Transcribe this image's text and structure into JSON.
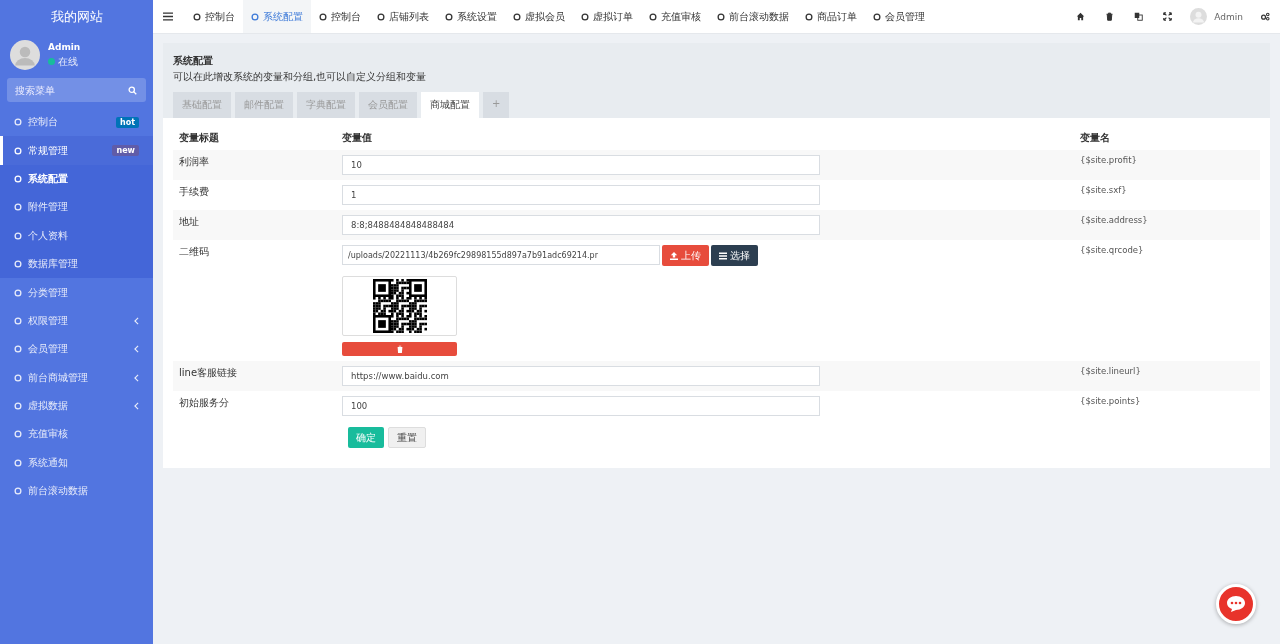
{
  "sidebar": {
    "site_title": "我的网站",
    "user": {
      "name": "Admin",
      "status": "在线",
      "online": true
    },
    "search": {
      "placeholder": "搜索菜单"
    },
    "items": [
      {
        "label": "控制台",
        "badge": {
          "text": "hot",
          "color": "#0073b7"
        },
        "selected": false
      },
      {
        "label": "常规管理",
        "badge": {
          "text": "new",
          "color": "#605ca8"
        },
        "selected": true,
        "expanded": true,
        "children": [
          {
            "label": "系统配置",
            "selected": true
          },
          {
            "label": "附件管理",
            "selected": false
          },
          {
            "label": "个人资料",
            "selected": false
          },
          {
            "label": "数据库管理",
            "selected": false
          }
        ]
      },
      {
        "label": "分类管理",
        "selected": false
      },
      {
        "label": "权限管理",
        "selected": false,
        "expanded": false
      },
      {
        "label": "会员管理",
        "selected": false,
        "expanded": false
      },
      {
        "label": "前台商城管理",
        "selected": false,
        "expanded": false
      },
      {
        "label": "虚拟数据",
        "selected": false,
        "expanded": false
      },
      {
        "label": "充值审核",
        "selected": false
      },
      {
        "label": "系统通知",
        "selected": false
      },
      {
        "label": "前台滚动数据",
        "selected": false
      }
    ]
  },
  "top_tabs": [
    {
      "label": "控制台",
      "selected": false
    },
    {
      "label": "系统配置",
      "selected": true
    },
    {
      "label": "控制台",
      "selected": false
    },
    {
      "label": "店铺列表",
      "selected": false
    },
    {
      "label": "系统设置",
      "selected": false
    },
    {
      "label": "虚拟会员",
      "selected": false
    },
    {
      "label": "虚拟订单",
      "selected": false
    },
    {
      "label": "充值审核",
      "selected": false
    },
    {
      "label": "前台滚动数据",
      "selected": false
    },
    {
      "label": "商品订单",
      "selected": false
    },
    {
      "label": "会员管理",
      "selected": false
    }
  ],
  "top_user": "Admin",
  "panel": {
    "title": "系统配置",
    "description": "可以在此增改系统的变量和分组,也可以自定义分组和变量",
    "tabs": [
      {
        "label": "基础配置",
        "selected": false
      },
      {
        "label": "邮件配置",
        "selected": false
      },
      {
        "label": "字典配置",
        "selected": false
      },
      {
        "label": "会员配置",
        "selected": false
      },
      {
        "label": "商城配置",
        "selected": true
      },
      {
        "label": "+",
        "selected": false
      }
    ],
    "columns": [
      "变量标题",
      "变量值",
      "变量名"
    ],
    "rows": [
      {
        "kind": "text",
        "title": "利润率",
        "value": "10",
        "name": "{$site.profit}"
      },
      {
        "kind": "text",
        "title": "手续费",
        "value": "1",
        "name": "{$site.sxf}"
      },
      {
        "kind": "text",
        "title": "地址",
        "value": "8:8;8488484848488484",
        "name": "{$site.address}"
      },
      {
        "kind": "image",
        "title": "二维码",
        "value": "/uploads/20221113/4b269fc29898155d897a7b91adc69214.pr",
        "upload": "上传",
        "choose": "选择",
        "name": "{$site.qrcode}"
      },
      {
        "kind": "text",
        "title": "line客服链接",
        "value": "https://www.baidu.com",
        "name": "{$site.lineurl}"
      },
      {
        "kind": "text",
        "title": "初始服务分",
        "value": "100",
        "name": "{$site.points}"
      }
    ],
    "buttons": {
      "submit": "确定",
      "reset": "重置"
    }
  }
}
